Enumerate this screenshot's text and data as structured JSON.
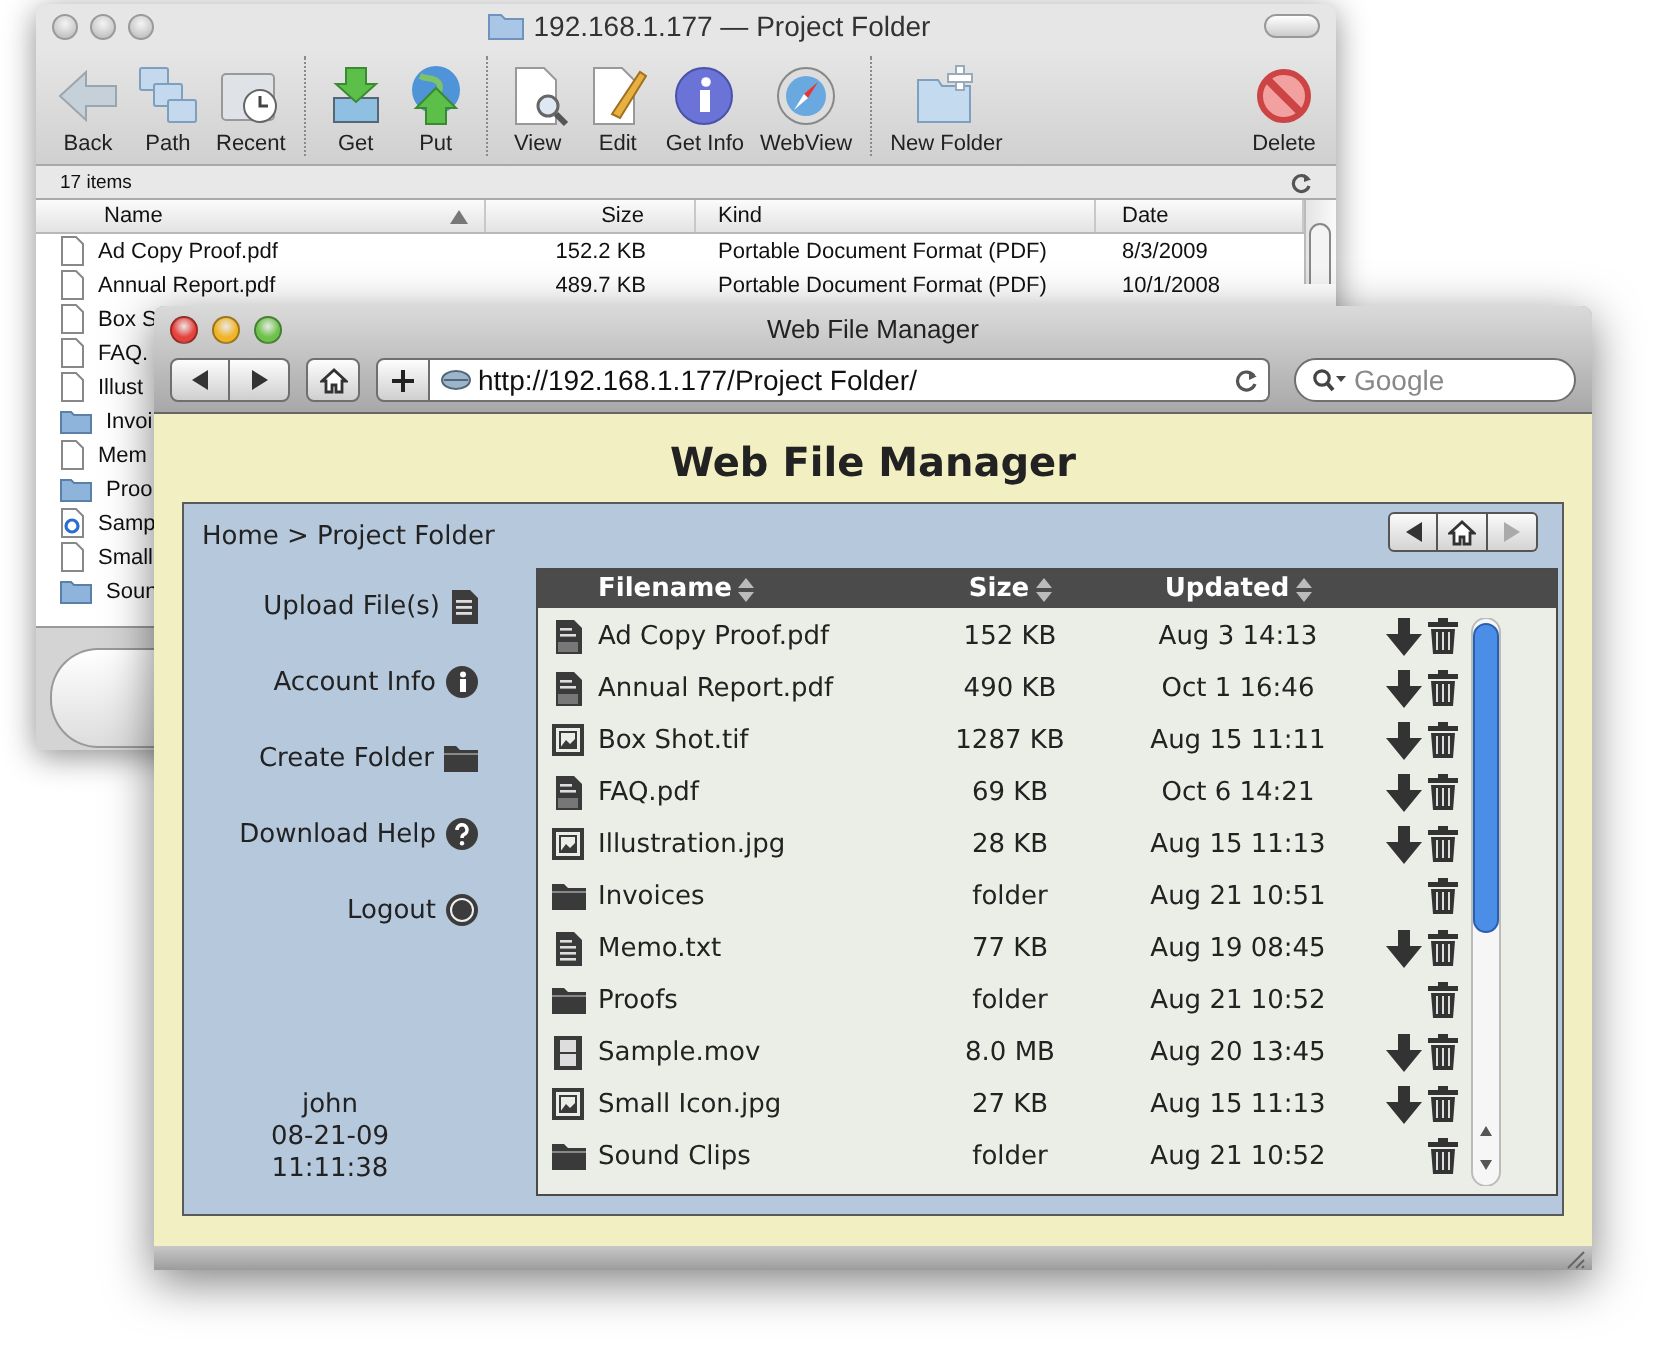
{
  "finder": {
    "title": "192.168.1.177 — Project Folder",
    "toolbar_groups": [
      [
        {
          "kind": "back",
          "label": "Back"
        },
        {
          "kind": "path",
          "label": "Path"
        },
        {
          "kind": "recent",
          "label": "Recent"
        }
      ],
      [
        {
          "kind": "get",
          "label": "Get"
        },
        {
          "kind": "put",
          "label": "Put"
        }
      ],
      [
        {
          "kind": "view",
          "label": "View"
        },
        {
          "kind": "edit",
          "label": "Edit"
        },
        {
          "kind": "info",
          "label": "Get Info"
        },
        {
          "kind": "webview",
          "label": "WebView"
        }
      ],
      [
        {
          "kind": "newfolder",
          "label": "New Folder"
        }
      ]
    ],
    "toolbar_right": [
      {
        "kind": "delete",
        "label": "Delete"
      }
    ],
    "status": "17 items",
    "columns": [
      "Name",
      "Size",
      "Kind",
      "Date"
    ],
    "rows": [
      {
        "kind": "document",
        "name": "Ad Copy Proof.pdf",
        "size": "152.2 KB",
        "kind_column": "Portable Document Format (PDF)",
        "date": "8/3/2009"
      },
      {
        "kind": "document",
        "name": "Annual Report.pdf",
        "size": "489.7 KB",
        "kind_column": "Portable Document Format (PDF)",
        "date": "10/1/2008"
      },
      {
        "kind": "document",
        "name": "Box S"
      },
      {
        "kind": "document",
        "name": "FAQ."
      },
      {
        "kind": "document",
        "name": "Illust"
      },
      {
        "kind": "folder",
        "name": "Invoi"
      },
      {
        "kind": "document",
        "name": "Mem"
      },
      {
        "kind": "folder",
        "name": "Proo"
      },
      {
        "kind": "media",
        "name": "Samp"
      },
      {
        "kind": "document",
        "name": "Small"
      },
      {
        "kind": "folder",
        "name": "Soun"
      }
    ]
  },
  "browser": {
    "title": "Web File Manager",
    "url": "http://192.168.1.177/Project Folder/",
    "search_placeholder": "Google"
  },
  "page": {
    "heading": "Web File Manager",
    "breadcrumb": "Home > Project Folder",
    "page_nav": [
      {
        "kind": "back",
        "disabled": false
      },
      {
        "kind": "home",
        "disabled": false
      },
      {
        "kind": "forward",
        "disabled": true
      }
    ],
    "menu": [
      {
        "kind": "upload",
        "label": "Upload File(s)"
      },
      {
        "kind": "info",
        "label": "Account Info"
      },
      {
        "kind": "folder",
        "label": "Create Folder"
      },
      {
        "kind": "help",
        "label": "Download Help"
      },
      {
        "kind": "logout",
        "label": "Logout"
      }
    ],
    "user": {
      "name": "john",
      "date": "08-21-09",
      "time": "11:11:38"
    },
    "table": {
      "columns": [
        "Filename",
        "Size",
        "Updated"
      ],
      "rows": [
        {
          "kind": "pdf",
          "name": "Ad Copy Proof.pdf",
          "size": "152 KB",
          "updated": "Aug 3 14:13",
          "actions": [
            {
              "kind": "download"
            },
            {
              "kind": "delete"
            }
          ]
        },
        {
          "kind": "pdf",
          "name": "Annual Report.pdf",
          "size": "490 KB",
          "updated": "Oct 1 16:46",
          "actions": [
            {
              "kind": "download"
            },
            {
              "kind": "delete"
            }
          ]
        },
        {
          "kind": "image",
          "name": "Box Shot.tif",
          "size": "1287 KB",
          "updated": "Aug 15 11:11",
          "actions": [
            {
              "kind": "download"
            },
            {
              "kind": "delete"
            }
          ]
        },
        {
          "kind": "pdf",
          "name": "FAQ.pdf",
          "size": "69 KB",
          "updated": "Oct 6 14:21",
          "actions": [
            {
              "kind": "download"
            },
            {
              "kind": "delete"
            }
          ]
        },
        {
          "kind": "image",
          "name": "Illustration.jpg",
          "size": "28 KB",
          "updated": "Aug 15 11:13",
          "actions": [
            {
              "kind": "download"
            },
            {
              "kind": "delete"
            }
          ]
        },
        {
          "kind": "folder",
          "name": "Invoices",
          "size": "folder",
          "updated": "Aug 21 10:51",
          "actions": [
            {
              "kind": "delete"
            }
          ]
        },
        {
          "kind": "text",
          "name": "Memo.txt",
          "size": "77 KB",
          "updated": "Aug 19 08:45",
          "actions": [
            {
              "kind": "download"
            },
            {
              "kind": "delete"
            }
          ]
        },
        {
          "kind": "folder",
          "name": "Proofs",
          "size": "folder",
          "updated": "Aug 21 10:52",
          "actions": [
            {
              "kind": "delete"
            }
          ]
        },
        {
          "kind": "movie",
          "name": "Sample.mov",
          "size": "8.0 MB",
          "updated": "Aug 20 13:45",
          "actions": [
            {
              "kind": "download"
            },
            {
              "kind": "delete"
            }
          ]
        },
        {
          "kind": "image",
          "name": "Small Icon.jpg",
          "size": "27 KB",
          "updated": "Aug 15 11:13",
          "actions": [
            {
              "kind": "download"
            },
            {
              "kind": "delete"
            }
          ]
        },
        {
          "kind": "folder",
          "name": "Sound Clips",
          "size": "folder",
          "updated": "Aug 21 10:52",
          "actions": [
            {
              "kind": "delete"
            }
          ]
        }
      ]
    }
  }
}
